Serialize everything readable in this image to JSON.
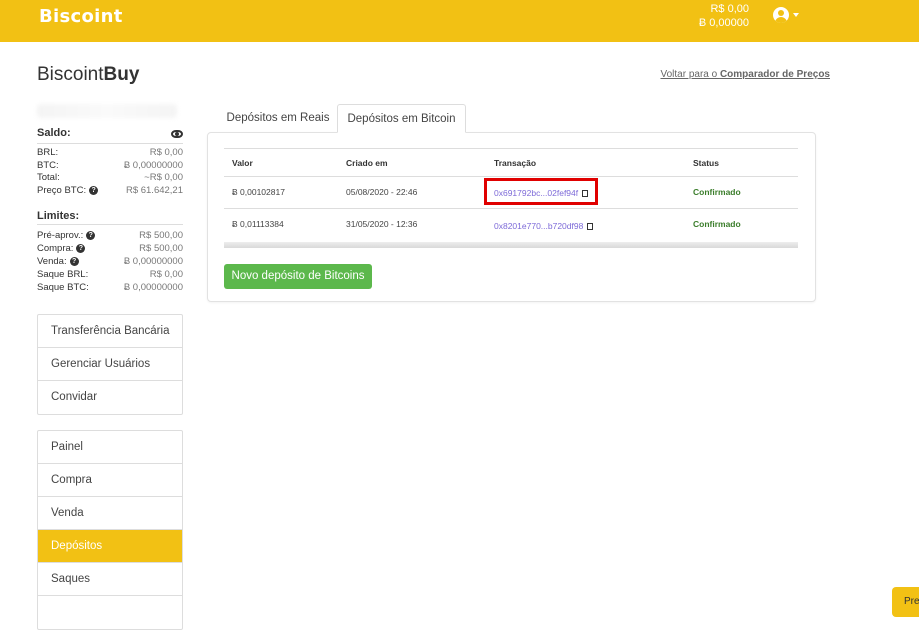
{
  "header": {
    "logo": "Biscoint",
    "balance_brl": "R$ 0,00",
    "balance_btc": "Ƀ 0,00000"
  },
  "brand": {
    "light": "Biscoint",
    "bold": "Buy"
  },
  "compare_link": {
    "prefix": "Voltar para o ",
    "bold": "Comparador de Preços"
  },
  "saldo": {
    "title": "Saldo:",
    "rows": [
      {
        "k": "BRL:",
        "v": "R$ 0,00"
      },
      {
        "k": "BTC:",
        "v": "Ƀ 0,00000000"
      },
      {
        "k": "Total:",
        "v": "~R$ 0,00",
        "help": true
      },
      {
        "k": "Preço BTC:",
        "v": "R$ 61.642,21",
        "help": true
      }
    ]
  },
  "limites": {
    "title": "Limites:",
    "rows": [
      {
        "k": "Pré-aprov.:",
        "v": "R$ 500,00",
        "help": true
      },
      {
        "k": "Compra:",
        "v": "R$ 500,00",
        "help": true
      },
      {
        "k": "Venda:",
        "v": "Ƀ 0,00000000",
        "help": true
      },
      {
        "k": "Saque BRL:",
        "v": "R$ 0,00"
      },
      {
        "k": "Saque BTC:",
        "v": "Ƀ 0,00000000"
      }
    ]
  },
  "menu1": [
    "Transferência Bancária",
    "Gerenciar Usuários",
    "Convidar"
  ],
  "menu2": [
    "Painel",
    "Compra",
    "Venda",
    "Depósitos",
    "Saques",
    ""
  ],
  "tabs": [
    "Depósitos em Reais",
    "Depósitos em Bitcoin"
  ],
  "table": {
    "headers": [
      "Valor",
      "Criado em",
      "Transação",
      "Status"
    ],
    "rows": [
      {
        "valor": "Ƀ 0,00102817",
        "criado": "05/08/2020 - 22:46",
        "tx": "0x691792bc...02fef94f",
        "status": "Confirmado"
      },
      {
        "valor": "Ƀ 0,01113384",
        "criado": "31/05/2020 - 12:36",
        "tx": "0x8201e770...b720df98",
        "status": "Confirmado"
      }
    ]
  },
  "button_new": "Novo depósito de Bitcoins",
  "corner_btn": "Pre",
  "colors": {
    "accent": "#f2c114",
    "green": "#5cb84c",
    "link": "#7d6ad8",
    "highlight": "#e00000"
  }
}
